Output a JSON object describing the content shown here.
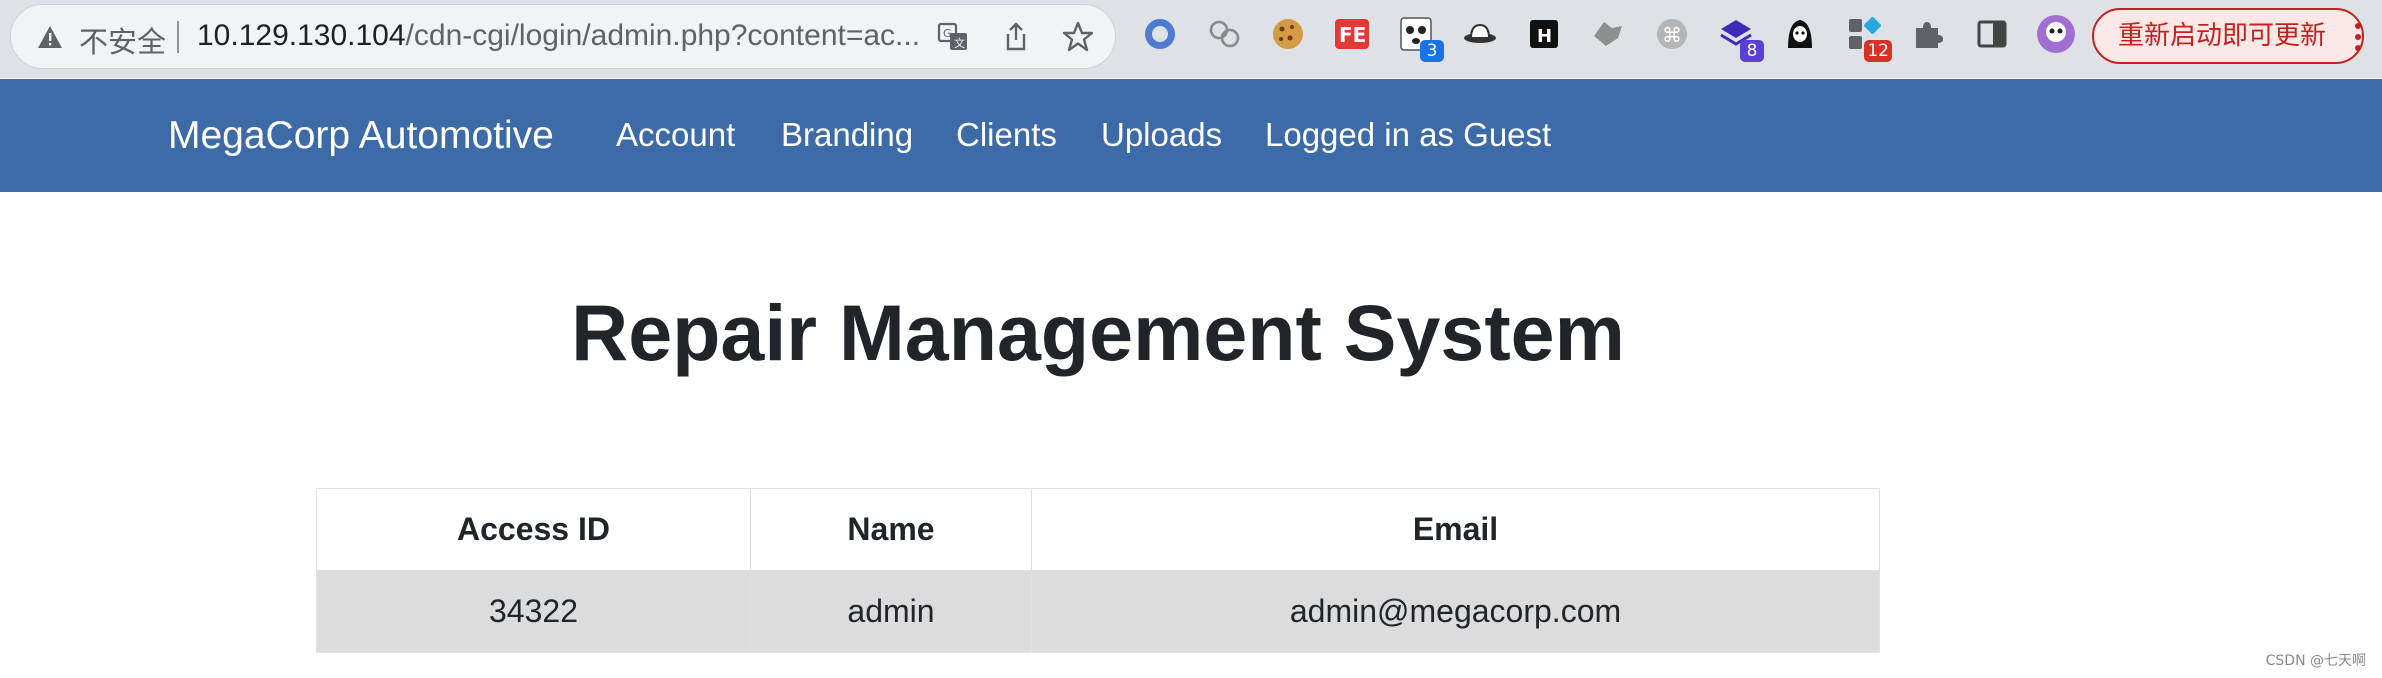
{
  "browser": {
    "security_label": "不安全",
    "url_host": "10.129.130.104",
    "url_path": "/cdn-cgi/login/admin.php?content=ac...",
    "extension_badges": {
      "ext_3": "3",
      "ext_8": "8",
      "ext_12": "12"
    },
    "restart_label": "重新启动即可更新"
  },
  "navbar": {
    "brand": "MegaCorp Automotive",
    "links": [
      "Account",
      "Branding",
      "Clients",
      "Uploads",
      "Logged in as Guest"
    ]
  },
  "main": {
    "title": "Repair Management System",
    "table": {
      "headers": [
        "Access ID",
        "Name",
        "Email"
      ],
      "rows": [
        [
          "34322",
          "admin",
          "admin@megacorp.com"
        ]
      ]
    }
  },
  "watermark": "CSDN @七天啊",
  "colors": {
    "navbar": "#3d6ba8",
    "row_bg": "#dcdcdc",
    "restart_accent": "#c5221f"
  },
  "icons": {
    "omnibox": [
      "warning-icon",
      "translate-icon",
      "share-icon",
      "star-icon"
    ],
    "extensions": [
      "ring-ext-icon",
      "bubbles-ext-icon",
      "cookie-ext-icon",
      "fe-ext-icon",
      "panda-ext-icon",
      "hat-ext-icon",
      "h-ext-icon",
      "fox-ext-icon",
      "command-ext-icon",
      "stack-ext-icon",
      "hacker-ext-icon",
      "apps-ext-icon",
      "puzzle-icon",
      "sidepanel-icon",
      "profile-avatar-icon",
      "kebab-menu-icon"
    ]
  }
}
